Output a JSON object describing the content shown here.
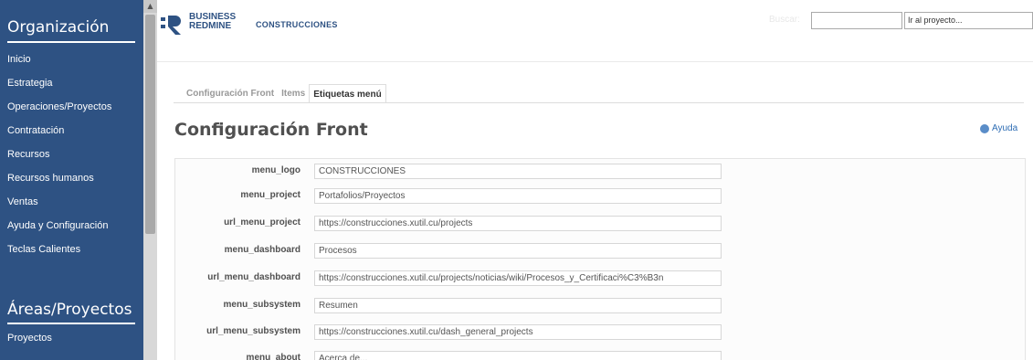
{
  "sidebar": {
    "org_heading": "Organización",
    "org_items": [
      {
        "label": "Inicio"
      },
      {
        "label": "Estrategia"
      },
      {
        "label": "Operaciones/Proyectos"
      },
      {
        "label": "Contratación"
      },
      {
        "label": "Recursos"
      },
      {
        "label": "Recursos humanos"
      },
      {
        "label": "Ventas"
      },
      {
        "label": "Ayuda y Configuración"
      },
      {
        "label": "Teclas Calientes"
      }
    ],
    "areas_heading": "Áreas/Proyectos",
    "areas_items": [
      {
        "label": "Proyectos"
      }
    ]
  },
  "header": {
    "logo_line1": "BUSINESS",
    "logo_line2": "REDMINE",
    "brand_title": "CONSTRUCCIONES",
    "search_label": "Buscar:",
    "search_value": "",
    "project_select": "Ir al proyecto..."
  },
  "tabs": [
    {
      "label": "Configuración Front",
      "active": false
    },
    {
      "label": "Items",
      "active": false
    },
    {
      "label": "Etiquetas menú",
      "active": true
    }
  ],
  "page_title": "Configuración Front",
  "help_label": "Ayuda",
  "form": {
    "fields": [
      {
        "label": "menu_logo",
        "value": "CONSTRUCCIONES"
      },
      {
        "label": "menu_project",
        "value": "Portafolios/Proyectos"
      },
      {
        "label": "url_menu_project",
        "value": "https://construcciones.xutil.cu/projects"
      },
      {
        "label": "menu_dashboard",
        "value": "Procesos"
      },
      {
        "label": "url_menu_dashboard",
        "value": "https://construcciones.xutil.cu/projects/noticias/wiki/Procesos_y_Certificaci%C3%B3n"
      },
      {
        "label": "menu_subsystem",
        "value": "Resumen"
      },
      {
        "label": "url_menu_subsystem",
        "value": "https://construcciones.xutil.cu/dash_general_projects"
      },
      {
        "label": "menu_about",
        "value": "Acerca de..."
      }
    ]
  },
  "colors": {
    "sidebar_bg": "#2e5283",
    "brand": "#2e5283",
    "link": "#2e6db4"
  }
}
